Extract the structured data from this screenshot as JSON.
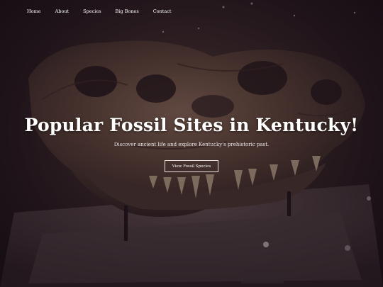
{
  "nav": {
    "items": [
      {
        "label": "Home"
      },
      {
        "label": "About"
      },
      {
        "label": "Species"
      },
      {
        "label": "Big Bones"
      },
      {
        "label": "Contact"
      }
    ]
  },
  "hero": {
    "title": "Popular Fossil Sites in Kentucky!",
    "subtitle": "Discover ancient life and explore Kentucky's prehistoric past.",
    "cta_label": "View Fossil Species"
  },
  "colors": {
    "overlay": "#1c101a",
    "text": "#ffffff"
  }
}
